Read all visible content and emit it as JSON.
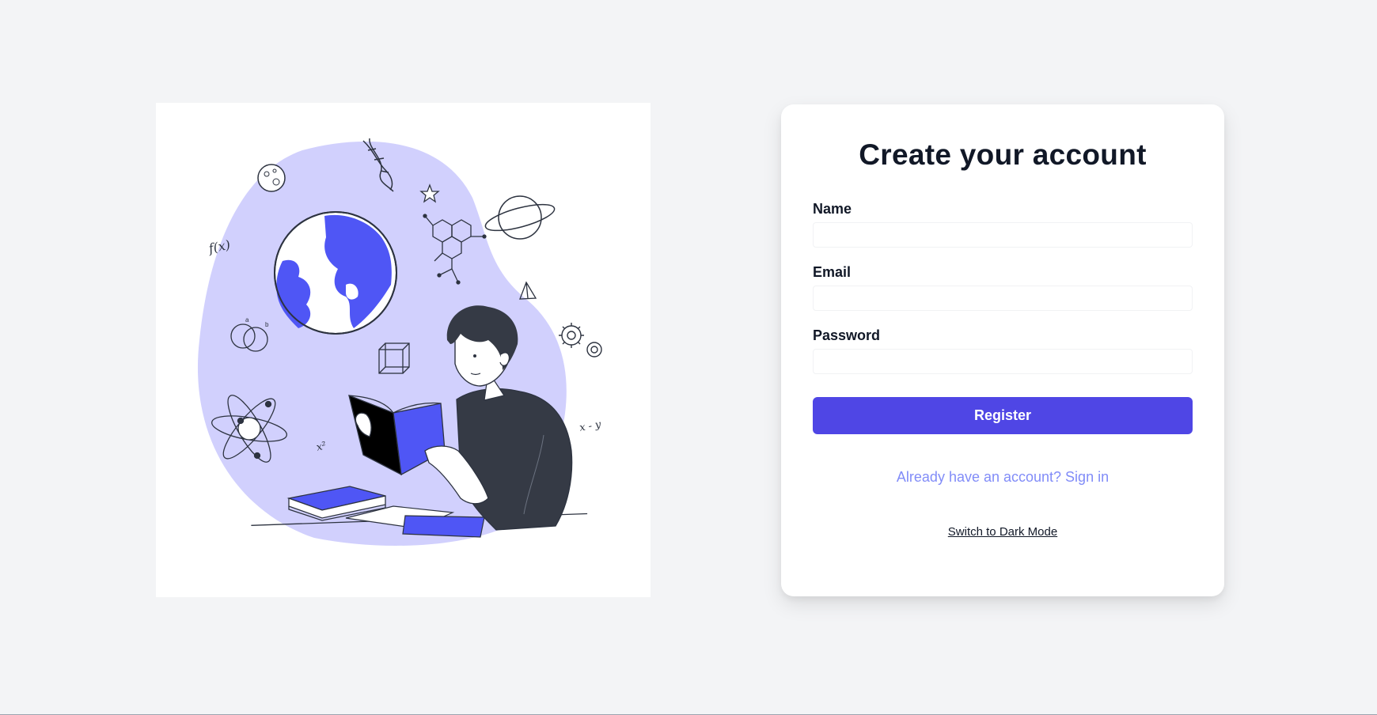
{
  "form": {
    "title": "Create your account",
    "fields": [
      {
        "label": "Name",
        "value": "",
        "placeholder": ""
      },
      {
        "label": "Email",
        "value": "",
        "placeholder": ""
      },
      {
        "label": "Password",
        "value": "",
        "placeholder": ""
      }
    ],
    "submit_label": "Register",
    "signin_link": "Already have an account? Sign in",
    "theme_toggle": "Switch to Dark Mode"
  },
  "illustration": {
    "icon": "student-reading-science-illustration",
    "formula_fx": "f(x)",
    "formula_x2": "x²",
    "formula_xy": "x - y"
  },
  "colors": {
    "background": "#f3f4f6",
    "accent": "#4f46e5",
    "link": "#818cf8",
    "blob": "#d1d0fd",
    "illustration_blue": "#4f56f5"
  }
}
